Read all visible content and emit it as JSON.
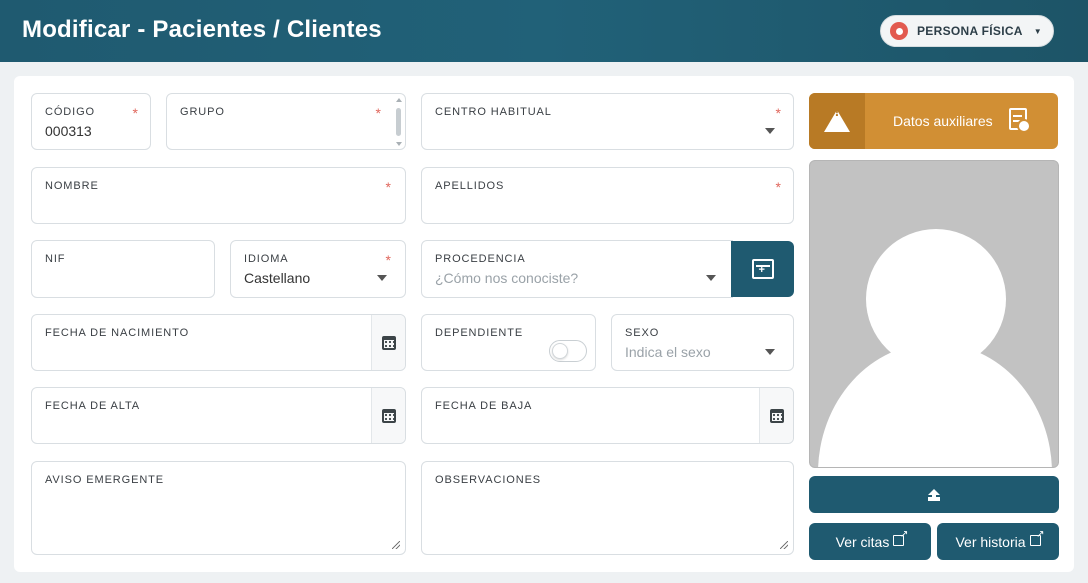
{
  "header": {
    "title": "Modificar - Pacientes / Clientes",
    "persona_label": "PERSONA FÍSICA"
  },
  "form": {
    "codigo": {
      "label": "CÓDIGO",
      "value": "000313",
      "required": "*"
    },
    "grupo": {
      "label": "GRUPO",
      "required": "*"
    },
    "centro_habitual": {
      "label": "CENTRO HABITUAL",
      "required": "*"
    },
    "nombre": {
      "label": "NOMBRE",
      "required": "*"
    },
    "apellidos": {
      "label": "APELLIDOS",
      "required": "*"
    },
    "nif": {
      "label": "NIF"
    },
    "idioma": {
      "label": "IDIOMA",
      "value": "Castellano",
      "required": "*"
    },
    "procedencia": {
      "label": "PROCEDENCIA",
      "placeholder": "¿Cómo nos conociste?"
    },
    "fecha_nacimiento": {
      "label": "FECHA DE NACIMIENTO"
    },
    "dependiente": {
      "label": "DEPENDIENTE",
      "checked": false
    },
    "sexo": {
      "label": "SEXO",
      "placeholder": "Indica el sexo"
    },
    "fecha_alta": {
      "label": "FECHA DE ALTA"
    },
    "fecha_baja": {
      "label": "FECHA DE BAJA"
    },
    "aviso_emergente": {
      "label": "AVISO EMERGENTE"
    },
    "observaciones": {
      "label": "OBSERVACIONES"
    }
  },
  "side": {
    "aux_label": "Datos auxiliares",
    "warning_mark": "!",
    "ver_citas": "Ver citas",
    "ver_historia": "Ver historia"
  },
  "icons": [
    "warning-icon",
    "clipboard-icon",
    "calendar-icon",
    "upload-icon",
    "external-link-icon",
    "chevron-down-icon",
    "add-list-icon"
  ],
  "colors": {
    "primary": "#1f5a70",
    "accent": "#d18f34",
    "required": "#e0665c"
  }
}
